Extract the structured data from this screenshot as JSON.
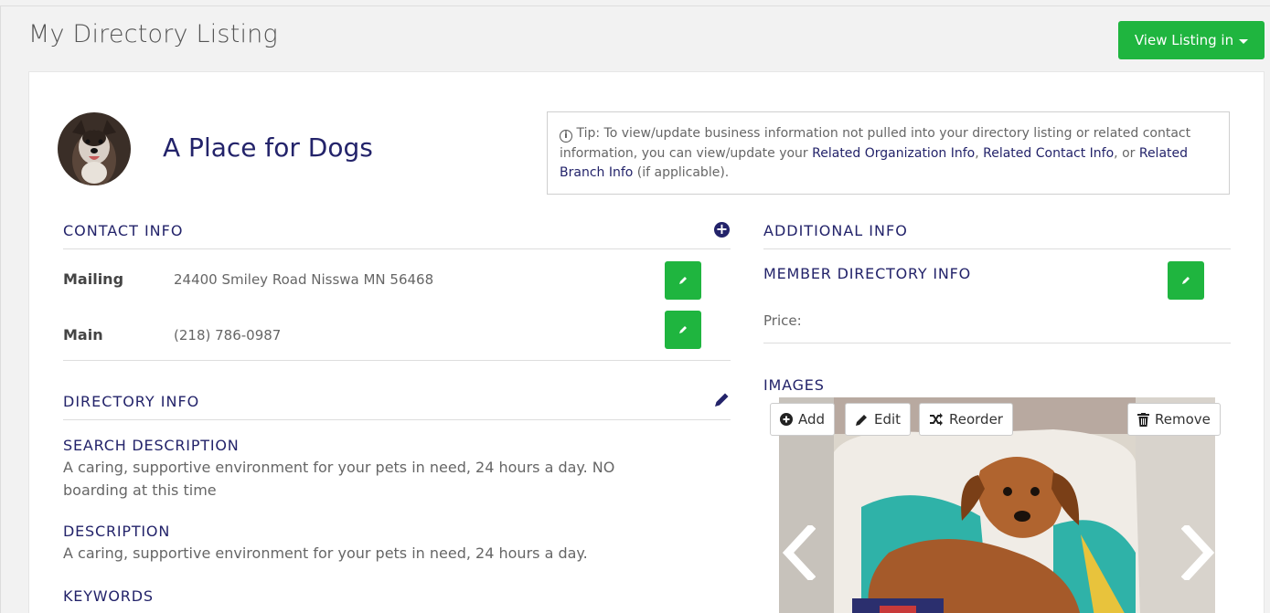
{
  "header": {
    "title": "My Directory Listing",
    "view_listing_label": "View Listing in"
  },
  "profile": {
    "name": "A Place for Dogs"
  },
  "tip": {
    "prefix": "Tip: To view/update business information not pulled into your directory listing or related contact information, you can view/update your ",
    "link1": "Related Organization Info",
    "sep1": ", ",
    "link2": "Related Contact Info",
    "sep2": ", or ",
    "link3": "Related Branch Info",
    "suffix": " (if applicable)."
  },
  "contact": {
    "heading": "CONTACT INFO",
    "mailing_label": "Mailing",
    "mailing_value": "24400 Smiley Road Nisswa MN 56468",
    "main_label": "Main",
    "main_value": "(218) 786-0987"
  },
  "directory": {
    "heading": "DIRECTORY INFO",
    "search_desc_label": "SEARCH DESCRIPTION",
    "search_desc_line1": "A caring, supportive environment for your pets in need, 24 hours a day. NO",
    "search_desc_line2": "boarding at this time",
    "desc_label": "DESCRIPTION",
    "desc_value": "A caring, supportive environment for your pets in need, 24 hours a day.",
    "keywords_label": "KEYWORDS"
  },
  "additional": {
    "heading": "ADDITIONAL INFO",
    "member_dir_label": "MEMBER DIRECTORY INFO",
    "price_label": "Price:"
  },
  "images": {
    "heading": "IMAGES",
    "add_label": "Add",
    "edit_label": "Edit",
    "reorder_label": "Reorder",
    "remove_label": "Remove"
  },
  "colors": {
    "brand_green": "#1fb53f",
    "navy": "#23236a"
  }
}
